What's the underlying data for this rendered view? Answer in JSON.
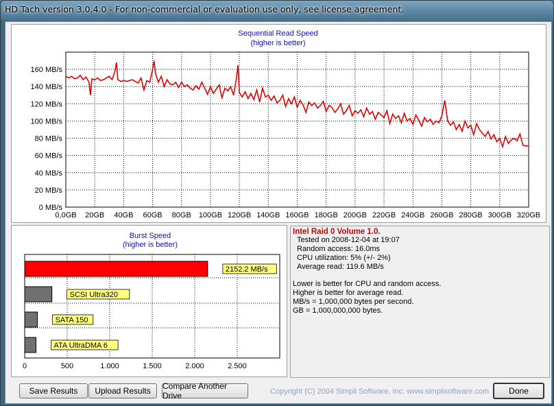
{
  "window": {
    "title": "HD Tach version 3.0.4.0  - For non-commercial or evaluation use only, see license agreement."
  },
  "sequential_chart": {
    "title": "Sequential Read Speed",
    "subtitle": "(higher is better)",
    "y_ticks": [
      "0 MB/s",
      "20 MB/s",
      "40 MB/s",
      "60 MB/s",
      "80 MB/s",
      "100 MB/s",
      "120 MB/s",
      "140 MB/s",
      "160 MB/s"
    ],
    "x_ticks": [
      "0,0GB",
      "20GB",
      "40GB",
      "60GB",
      "80GB",
      "100GB",
      "120GB",
      "140GB",
      "160GB",
      "180GB",
      "200GB",
      "220GB",
      "240GB",
      "260GB",
      "280GB",
      "300GB",
      "320GB"
    ],
    "line_color": "#e00000"
  },
  "burst_chart": {
    "title": "Burst Speed",
    "subtitle": "(higher is better)",
    "x_ticks": [
      "0",
      "500",
      "1.000",
      "1.500",
      "2.000",
      "2.500"
    ],
    "bar_color": "#ff0000",
    "ref_color": "#707070",
    "label_bg": "#ffff80"
  },
  "info": {
    "header": "Intel Raid 0 Volume 1.0.",
    "tested_on": "Tested on 2008-12-04 at 19:07",
    "random_access": "Random access: 16.0ms",
    "cpu": "CPU utilization: 5% (+/- 2%)",
    "avg_read": "Average read: 119.6 MB/s",
    "note1": "Lower is better for CPU and random access.",
    "note2": "Higher is better for average read.",
    "note3": "MB/s = 1,000,000 bytes per second.",
    "note4": "GB = 1,000,000,000 bytes."
  },
  "buttons": {
    "save": "Save Results",
    "upload": "Upload Results",
    "compare": "Compare Another Drive",
    "done": "Done"
  },
  "copyright": "Copyright (C) 2004 Simpli Software, Inc. www.simplisoftware.com",
  "chart_data": [
    {
      "type": "line",
      "title": "Sequential Read Speed",
      "subtitle": "(higher is better)",
      "xlabel": "",
      "ylabel": "",
      "xlim": [
        0,
        320
      ],
      "ylim": [
        0,
        180
      ],
      "x_unit": "GB",
      "y_unit": "MB/s",
      "grid": true,
      "x": [
        0,
        2,
        4,
        6,
        8,
        10,
        12,
        14,
        16,
        17,
        18,
        20,
        22,
        24,
        26,
        28,
        30,
        32,
        34,
        35,
        36,
        38,
        40,
        42,
        44,
        46,
        48,
        50,
        52,
        54,
        56,
        58,
        60,
        61,
        62,
        64,
        66,
        68,
        70,
        72,
        74,
        76,
        78,
        80,
        82,
        84,
        86,
        88,
        90,
        92,
        94,
        96,
        98,
        100,
        102,
        104,
        106,
        108,
        110,
        112,
        114,
        116,
        118,
        119,
        120,
        122,
        124,
        126,
        128,
        130,
        132,
        134,
        136,
        138,
        140,
        142,
        144,
        146,
        148,
        150,
        152,
        154,
        156,
        158,
        160,
        162,
        164,
        166,
        168,
        170,
        172,
        174,
        176,
        178,
        180,
        182,
        184,
        186,
        188,
        190,
        192,
        194,
        196,
        198,
        200,
        202,
        204,
        206,
        208,
        210,
        212,
        214,
        216,
        218,
        220,
        222,
        224,
        226,
        228,
        230,
        232,
        234,
        236,
        238,
        240,
        242,
        244,
        246,
        248,
        250,
        252,
        254,
        256,
        258,
        260,
        262,
        264,
        266,
        268,
        270,
        272,
        274,
        276,
        278,
        280,
        282,
        284,
        286,
        288,
        290,
        292,
        294,
        296,
        298,
        300,
        302,
        304,
        306,
        308,
        310,
        312,
        314,
        316,
        318,
        320
      ],
      "y": [
        152,
        150,
        152,
        149,
        150,
        153,
        148,
        151,
        145,
        130,
        149,
        148,
        150,
        147,
        148,
        150,
        152,
        148,
        158,
        168,
        148,
        146,
        147,
        146,
        147,
        148,
        146,
        144,
        150,
        136,
        147,
        145,
        160,
        170,
        155,
        145,
        152,
        140,
        148,
        143,
        142,
        145,
        139,
        145,
        140,
        142,
        138,
        136,
        141,
        137,
        145,
        138,
        131,
        140,
        132,
        137,
        142,
        127,
        138,
        135,
        140,
        130,
        150,
        165,
        133,
        128,
        134,
        126,
        132,
        125,
        136,
        122,
        138,
        128,
        130,
        124,
        129,
        121,
        124,
        130,
        117,
        126,
        120,
        128,
        116,
        124,
        119,
        110,
        122,
        118,
        121,
        115,
        118,
        123,
        111,
        118,
        116,
        110,
        114,
        120,
        108,
        112,
        118,
        106,
        112,
        109,
        113,
        105,
        115,
        108,
        111,
        102,
        110,
        107,
        104,
        112,
        97,
        108,
        103,
        106,
        98,
        109,
        100,
        103,
        96,
        107,
        101,
        94,
        104,
        99,
        102,
        96,
        100,
        98,
        106,
        124,
        100,
        95,
        99,
        90,
        96,
        88,
        100,
        92,
        95,
        84,
        97,
        90,
        86,
        82,
        88,
        79,
        84,
        76,
        80,
        70,
        82,
        74,
        78,
        80,
        77,
        85,
        72,
        71,
        71
      ]
    },
    {
      "type": "bar",
      "title": "Burst Speed",
      "subtitle": "(higher is better)",
      "categories": [
        "Intel Raid 0 Volume 1.0.",
        "SCSI Ultra320",
        "SATA 150",
        "ATA UltraDMA 6"
      ],
      "values": [
        2152.2,
        320,
        150,
        133
      ],
      "value_labels": [
        "2152.2 MB/s",
        "SCSI Ultra320",
        "SATA 150",
        "ATA UltraDMA 6"
      ],
      "xlim": [
        0,
        3000
      ],
      "x_unit": "MB/s",
      "orientation": "horizontal"
    }
  ]
}
